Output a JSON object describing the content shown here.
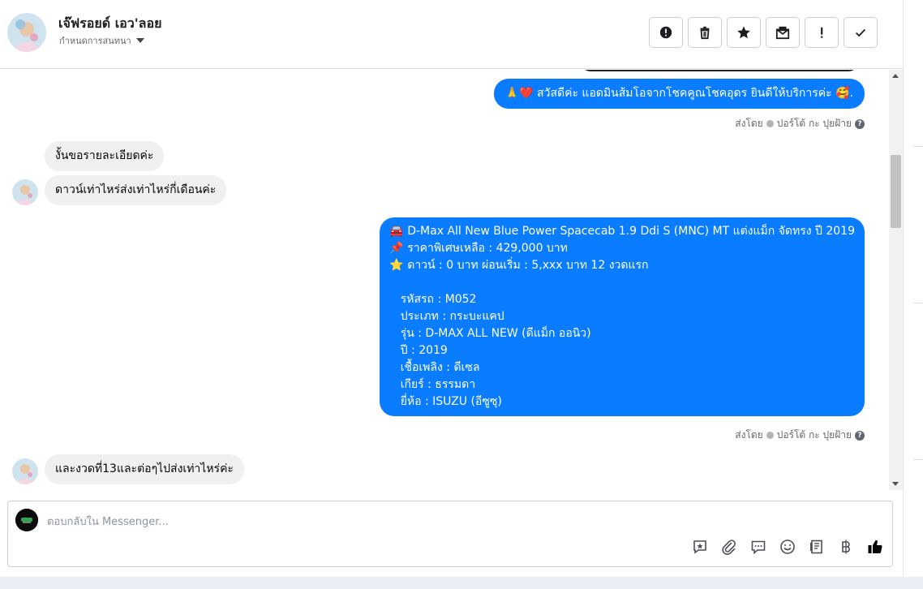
{
  "header": {
    "contact_name": "เจ๊ฟรอยด์ เอว'ลอย",
    "subtitle": "กำหนดการสนทนา"
  },
  "toolbar": {
    "buttons": [
      {
        "icon": "alert-circle-icon"
      },
      {
        "icon": "trash-icon"
      },
      {
        "icon": "star-icon"
      },
      {
        "icon": "mark-unread-icon"
      },
      {
        "icon": "exclamation-icon"
      },
      {
        "icon": "check-icon"
      }
    ]
  },
  "thread": {
    "messages": [
      {
        "side": "out",
        "text": "🙏❤️ สวัสดีค่ะ แอดมินส้มโอจากโชคคูณโชคอุดร ยินดีให้บริการค่ะ 🥰."
      },
      {
        "side": "in",
        "text": "งั้นขอรายละเอียดค่ะ"
      },
      {
        "side": "in",
        "text": "ดาวน์เท่าไหร่ส่งเท่าไหร่กี่เดือนค่ะ"
      },
      {
        "side": "out",
        "text": "🚘 D-Max All New Blue Power Spacecab 1.9 Ddi S (MNC) MT แต่งแม็ก จัดทรง ปี 2019\n📌 ราคาพิเศษเหลือ : 429,000 บาท\n⭐ ดาวน์ : 0 บาท ผ่อนเริ่ม : 5,xxx บาท 12 งวดแรก\n\n   รหัสรถ : M052\n   ประเภท : กระบะแคป\n   รุ่น : D-MAX ALL NEW (ดีแม็ก ออนิว)\n   ปี : 2019\n   เชื้อเพลิง : ดีเซล\n   เกียร์ : ธรรมดา\n   ยี่ห้อ : ISUZU (อีซูซุ)"
      },
      {
        "side": "in",
        "text": "และงวดที่13และต่อๆไปส่งเท่าไหร่ค่ะ"
      }
    ],
    "sent_by_label": "ส่งโดย",
    "sent_by_name": "ปอร์โต้ กะ ปุยฝ้าย",
    "help_glyph": "?"
  },
  "composer": {
    "placeholder": "ตอบกลับใน Messenger...",
    "icons": [
      "saved-reply-icon",
      "paperclip-icon",
      "chat-bubble-icon",
      "emoji-icon",
      "notes-icon",
      "baht-icon",
      "thumbs-up-icon"
    ]
  },
  "colors": {
    "outgoing_bubble": "#0a7cff",
    "incoming_bubble": "#f0f0f0",
    "like_button": "#050505"
  }
}
